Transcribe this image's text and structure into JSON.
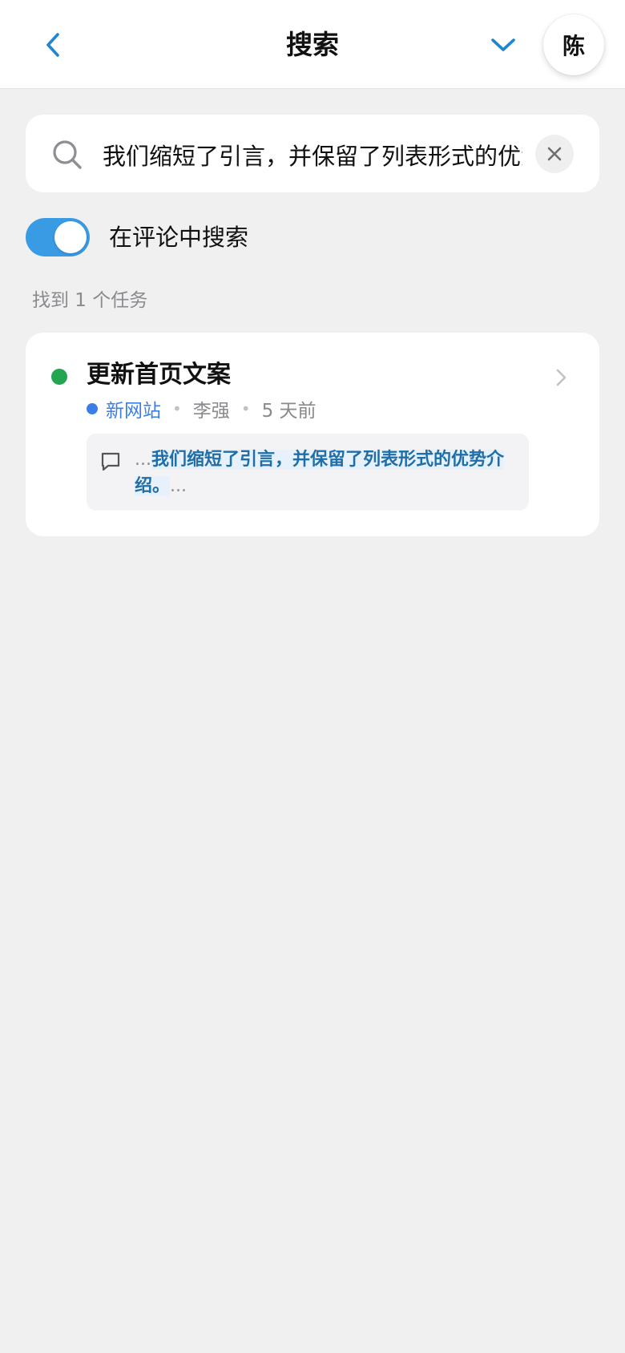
{
  "header": {
    "title": "搜索",
    "avatar_initial": "陈"
  },
  "search": {
    "query": "我们缩短了引言，并保留了列表形式的优势介绍。"
  },
  "filters": {
    "search_in_comments_label": "在评论中搜索",
    "search_in_comments_on": true
  },
  "results": {
    "count_label": "找到 1 个任务",
    "tasks": [
      {
        "title": "更新首页文案",
        "project": "新网站",
        "assignee": "李强",
        "time": "5 天前",
        "comment_prefix": "...",
        "comment_match": "我们缩短了引言，并保留了列表形式的优势介绍。",
        "comment_suffix": "..."
      }
    ]
  },
  "colors": {
    "accent": "#3a9be5",
    "status_done": "#22a652",
    "project": "#3b7fe6",
    "highlight_text": "#1f6ea8"
  }
}
